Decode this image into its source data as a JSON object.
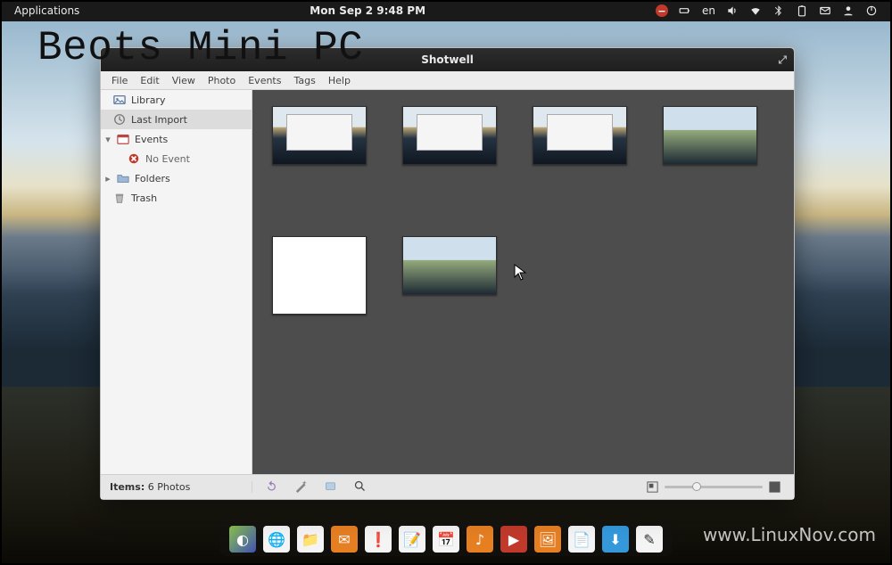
{
  "panel": {
    "applications": "Applications",
    "clock": "Mon Sep 2  9:48 PM",
    "lang": "en"
  },
  "watermark": {
    "title": "Beots Mini PC",
    "url": "www.LinuxNov.com"
  },
  "window": {
    "title": "Shotwell",
    "menu": [
      "File",
      "Edit",
      "View",
      "Photo",
      "Events",
      "Tags",
      "Help"
    ],
    "sidebar": {
      "library": "Library",
      "last_import": "Last Import",
      "events": "Events",
      "no_event": "No Event",
      "folders": "Folders",
      "trash": "Trash"
    },
    "status": {
      "items_label": "Items:",
      "items_value": "6 Photos"
    }
  },
  "dock": {
    "items": [
      "apps",
      "web",
      "files",
      "mail",
      "tasks",
      "notes",
      "calendar",
      "music",
      "video",
      "images",
      "docs",
      "download",
      "edit"
    ]
  }
}
